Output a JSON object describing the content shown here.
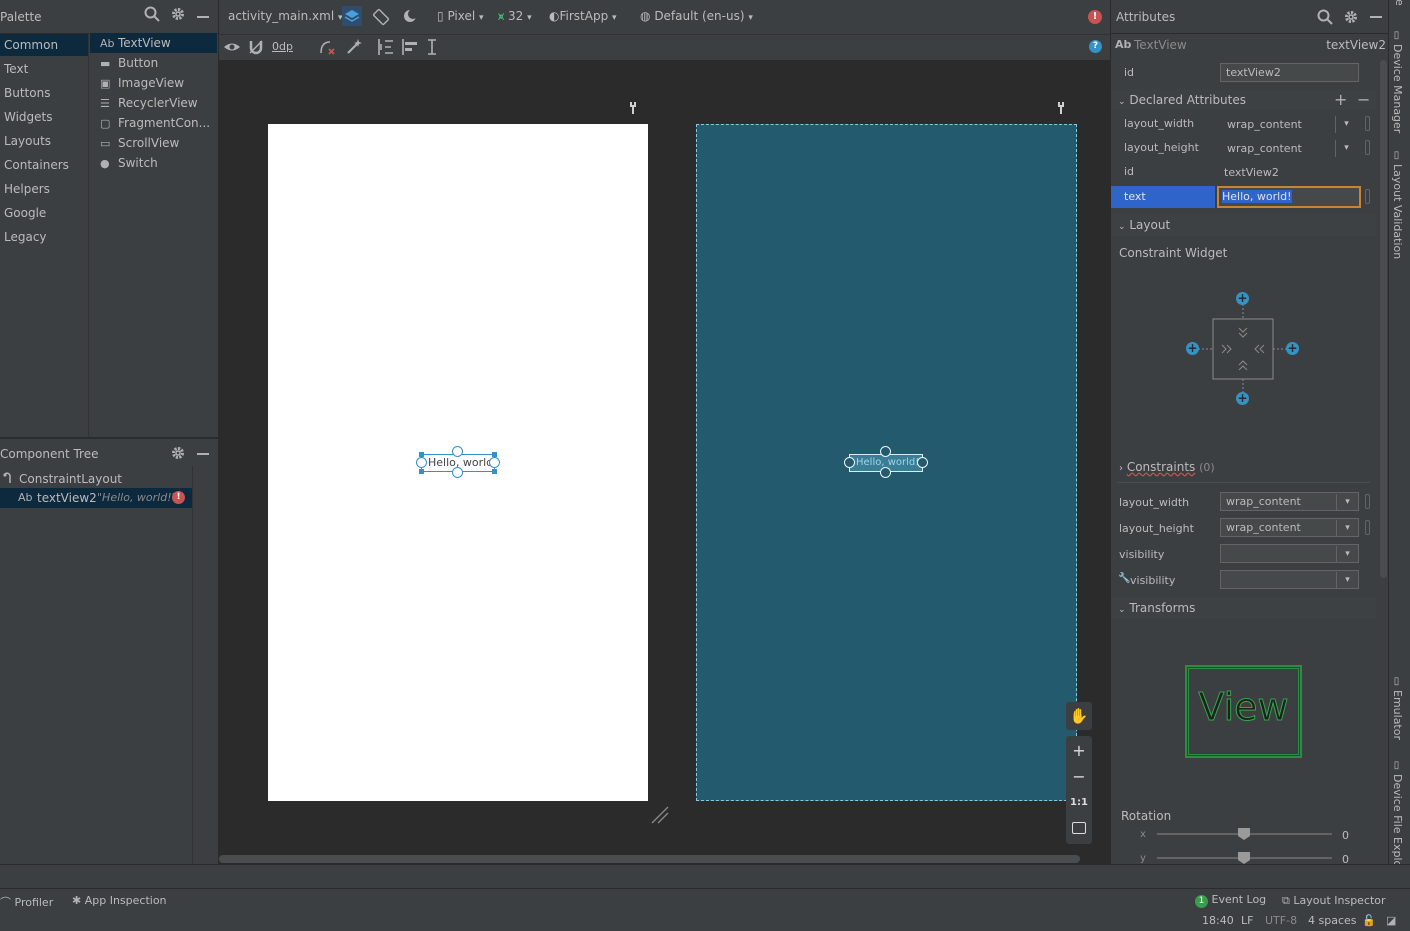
{
  "palette": {
    "title": "Palette",
    "categories": [
      "Common",
      "Text",
      "Buttons",
      "Widgets",
      "Layouts",
      "Containers",
      "Helpers",
      "Google",
      "Legacy"
    ],
    "items": [
      {
        "icon": "Ab",
        "label": "TextView"
      },
      {
        "icon": "▬",
        "label": "Button"
      },
      {
        "icon": "▣",
        "label": "ImageView"
      },
      {
        "icon": "☰",
        "label": "RecyclerView"
      },
      {
        "icon": "▢",
        "label": "FragmentCon..."
      },
      {
        "icon": "▭",
        "label": "ScrollView"
      },
      {
        "icon": "●",
        "label": "Switch"
      }
    ]
  },
  "component_tree": {
    "title": "Component Tree",
    "root": "ConstraintLayout",
    "child_icon": "Ab",
    "child_name": "textView2",
    "child_text": "\"Hello, world!\""
  },
  "toolbar": {
    "file": "activity_main.xml",
    "device": "Pixel",
    "api": "32",
    "theme": "FirstApp",
    "locale": "Default (en-us)",
    "margin": "0dp"
  },
  "canvas": {
    "design_text": "Hello, world!",
    "blueprint_text": "Hello, world!",
    "zoom_reset": "1:1",
    "colors": {
      "blueprint": "#235a6d",
      "design": "#ffffff",
      "selection": "#3592c4"
    }
  },
  "attributes": {
    "title": "Attributes",
    "widget_icon": "Ab",
    "widget_type": "TextView",
    "widget_id": "textView2",
    "id_label": "id",
    "id_value": "textView2",
    "declared_title": "Declared Attributes",
    "declared": [
      {
        "label": "layout_width",
        "value": "wrap_content"
      },
      {
        "label": "layout_height",
        "value": "wrap_content"
      },
      {
        "label": "id",
        "value": "textView2"
      },
      {
        "label": "text",
        "value": "Hello, world!"
      }
    ],
    "layout_title": "Layout",
    "constraint_widget": "Constraint Widget",
    "constraints_label": "Constraints",
    "constraints_count": "(0)",
    "layout_rows": [
      {
        "label": "layout_width",
        "value": "wrap_content"
      },
      {
        "label": "layout_height",
        "value": "wrap_content"
      },
      {
        "label": "visibility",
        "value": ""
      },
      {
        "label": "visibility",
        "value": ""
      }
    ],
    "transforms_title": "Transforms",
    "view_label": "View",
    "rotation_label": "Rotation",
    "rotation_x_label": "x",
    "rotation_x_value": "0",
    "rotation_y_label": "y",
    "rotation_y_value": "0"
  },
  "right_tabs": [
    "Device Manager",
    "Layout Validation",
    "Emulator",
    "Device File Explorer"
  ],
  "right_top_cut": "le",
  "bottom_bar": {
    "profiler": "Profiler",
    "app_inspection": "App Inspection",
    "event_log": "Event Log",
    "event_count": "1",
    "layout_inspector": "Layout Inspector"
  },
  "status": {
    "position": "18:40",
    "line_ending": "LF",
    "encoding": "UTF-8",
    "indent": "4 spaces"
  }
}
